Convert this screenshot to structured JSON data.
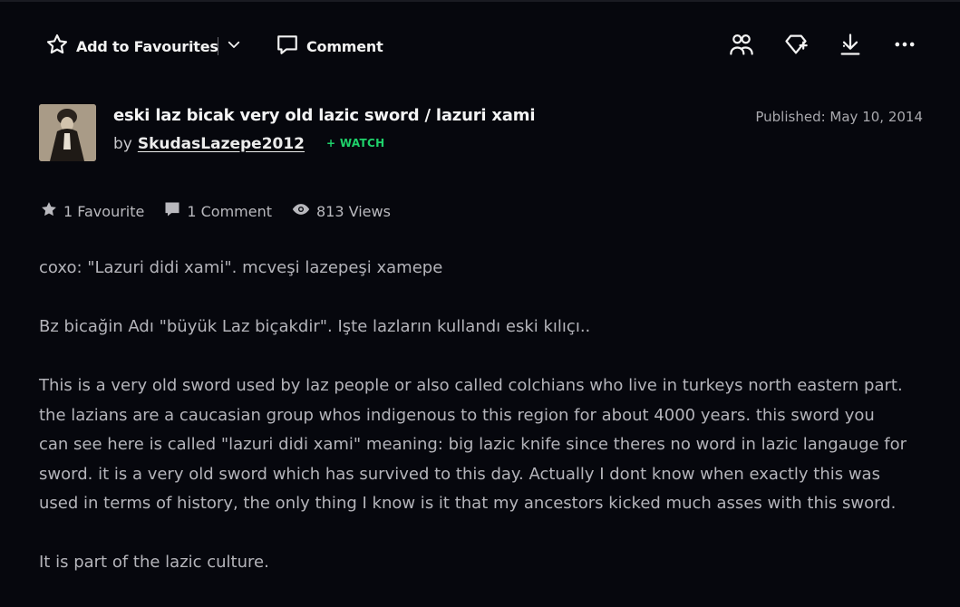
{
  "toolbar": {
    "favourite_label": "Add to Favourites",
    "comment_label": "Comment",
    "icons": [
      "star-outline-icon",
      "chevron-down-icon",
      "comment-icon",
      "group-icon",
      "badge-add-icon",
      "download-icon",
      "more-icon"
    ]
  },
  "deviation": {
    "title": "eski laz bicak very old lazic sword / lazuri xami",
    "by_label": "by",
    "author": "SkudasLazepe2012",
    "watch_label": "+ WATCH",
    "published": "Published: May 10, 2014"
  },
  "stats": {
    "favourites": "1 Favourite",
    "comments": "1 Comment",
    "views": "813 Views"
  },
  "description": {
    "paragraphs": [
      "coxo: \"Lazuri didi xami\". mcveşi lazepeşi xamepe",
      "Bz bicağin Adı \"büyük Laz biçakdir\". Işte lazların kullandı eski kılıçı..",
      "This is a very old sword used by laz people or also called colchians who live in turkeys north eastern part.\nthe lazians are a caucasian group whos indigenous to this region for about 4000 years. this sword you\ncan see here is called \"lazuri didi xami\" meaning: big lazic knife since theres no word in lazic langauge for\nsword. it is a very old sword which has survived to this day. Actually I dont know when  exactly this was\nused in terms of history, the only thing I know is it that my ancestors kicked much asses with this sword.",
      "It is part of the lazic culture."
    ]
  },
  "colors": {
    "background": "#06070d",
    "watch": "#1fd26b",
    "text": "#b4b4ba"
  }
}
